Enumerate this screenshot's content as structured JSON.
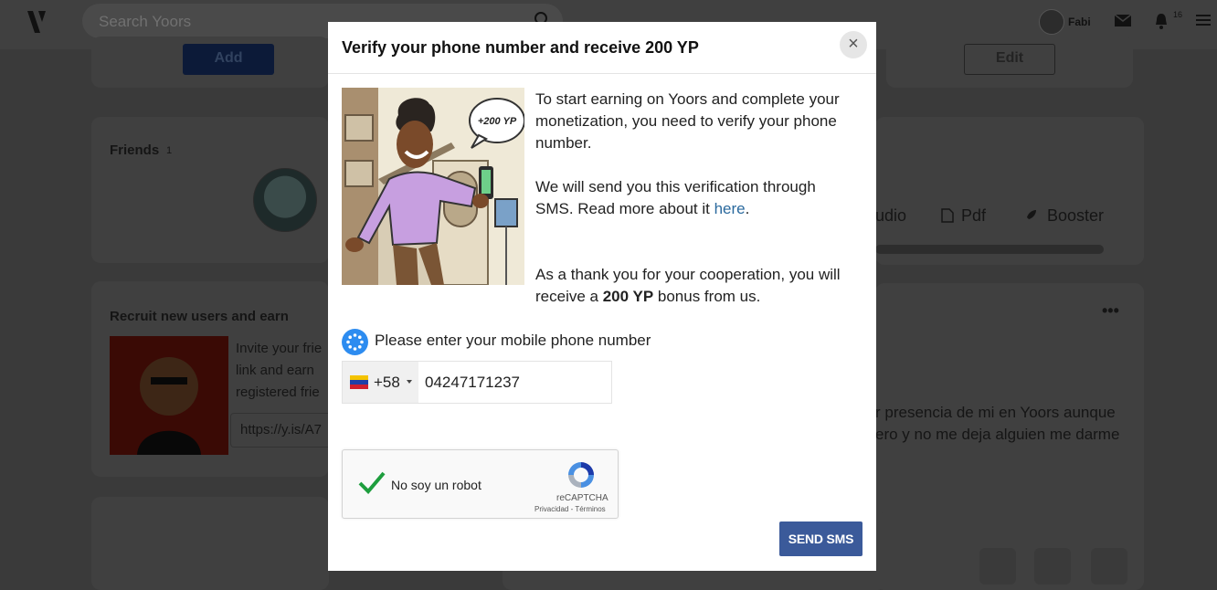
{
  "background": {
    "search_placeholder": "Search Yoors",
    "user_name": "Fabi",
    "notification_count": "16",
    "add_label": "Add",
    "edit_label": "Edit",
    "friends_title": "Friends",
    "friends_count": "1",
    "recruit_title": "Recruit new users and earn",
    "recruit_text": "Invite your frie link and earn registered frie",
    "recruit_link": "https://y.is/A7",
    "media_items": [
      "udio",
      "Pdf",
      "Booster"
    ],
    "post_text": "r presencia de mi en Yoors aunque ero y no me deja alguien me darme"
  },
  "modal": {
    "title": "Verify your phone number and receive 200 YP",
    "close_symbol": "×",
    "illustration_bubble": "+200 YP",
    "para1": "To start earning on Yoors and complete your monetization, you need to verify your phone number.",
    "para2_pre": "We will send you this verification through SMS. Read more about it ",
    "para2_link": "here",
    "para2_post": ".",
    "para3_pre": "As a thank you for your cooperation, you will receive a ",
    "para3_bold": "200 YP",
    "para3_post": " bonus from us.",
    "phone_label": "Please enter your mobile phone number",
    "country_code": "+58",
    "phone_value": "04247171237",
    "captcha_label": "No soy un robot",
    "captcha_brand": "reCAPTCHA",
    "captcha_terms": "Privacidad - Términos",
    "send_label": "SEND SMS"
  },
  "colors": {
    "send_button": "#3b5a9a",
    "captcha_check": "#1e9e3e",
    "link": "#2b6a9e",
    "spinner": "#2d8cf0"
  }
}
